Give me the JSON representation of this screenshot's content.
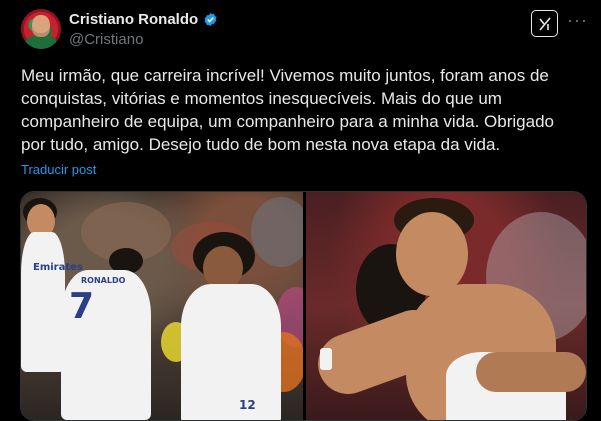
{
  "author": {
    "display_name": "Cristiano Ronaldo",
    "handle": "@Cristiano",
    "verified_icon": "verified-badge-icon",
    "verified_color": "#1d9bf0"
  },
  "actions": {
    "grok_icon": "grok-icon",
    "more_label": "···"
  },
  "tweet": {
    "text": "Meu irmão, que carreira incrível! Vivemos muito juntos, foram anos de conquistas, vitórias e momentos inesquecíveis. Mais do que um companheiro de equipa, um companheiro para a minha vida. Obrigado por tudo, amigo. Desejo tudo de bom nesta nova etapa da vida.",
    "translate_label": "Traducir post"
  },
  "media": {
    "left_photo": {
      "jersey_number_back": "7",
      "jersey_name_back": "RONALDO",
      "sponsor": "Emirates",
      "shorts_number": "12"
    },
    "right_photo": {}
  },
  "colors": {
    "background": "#000000",
    "text": "#e7e9ea",
    "secondary": "#71767b",
    "link": "#1d9bf0"
  }
}
